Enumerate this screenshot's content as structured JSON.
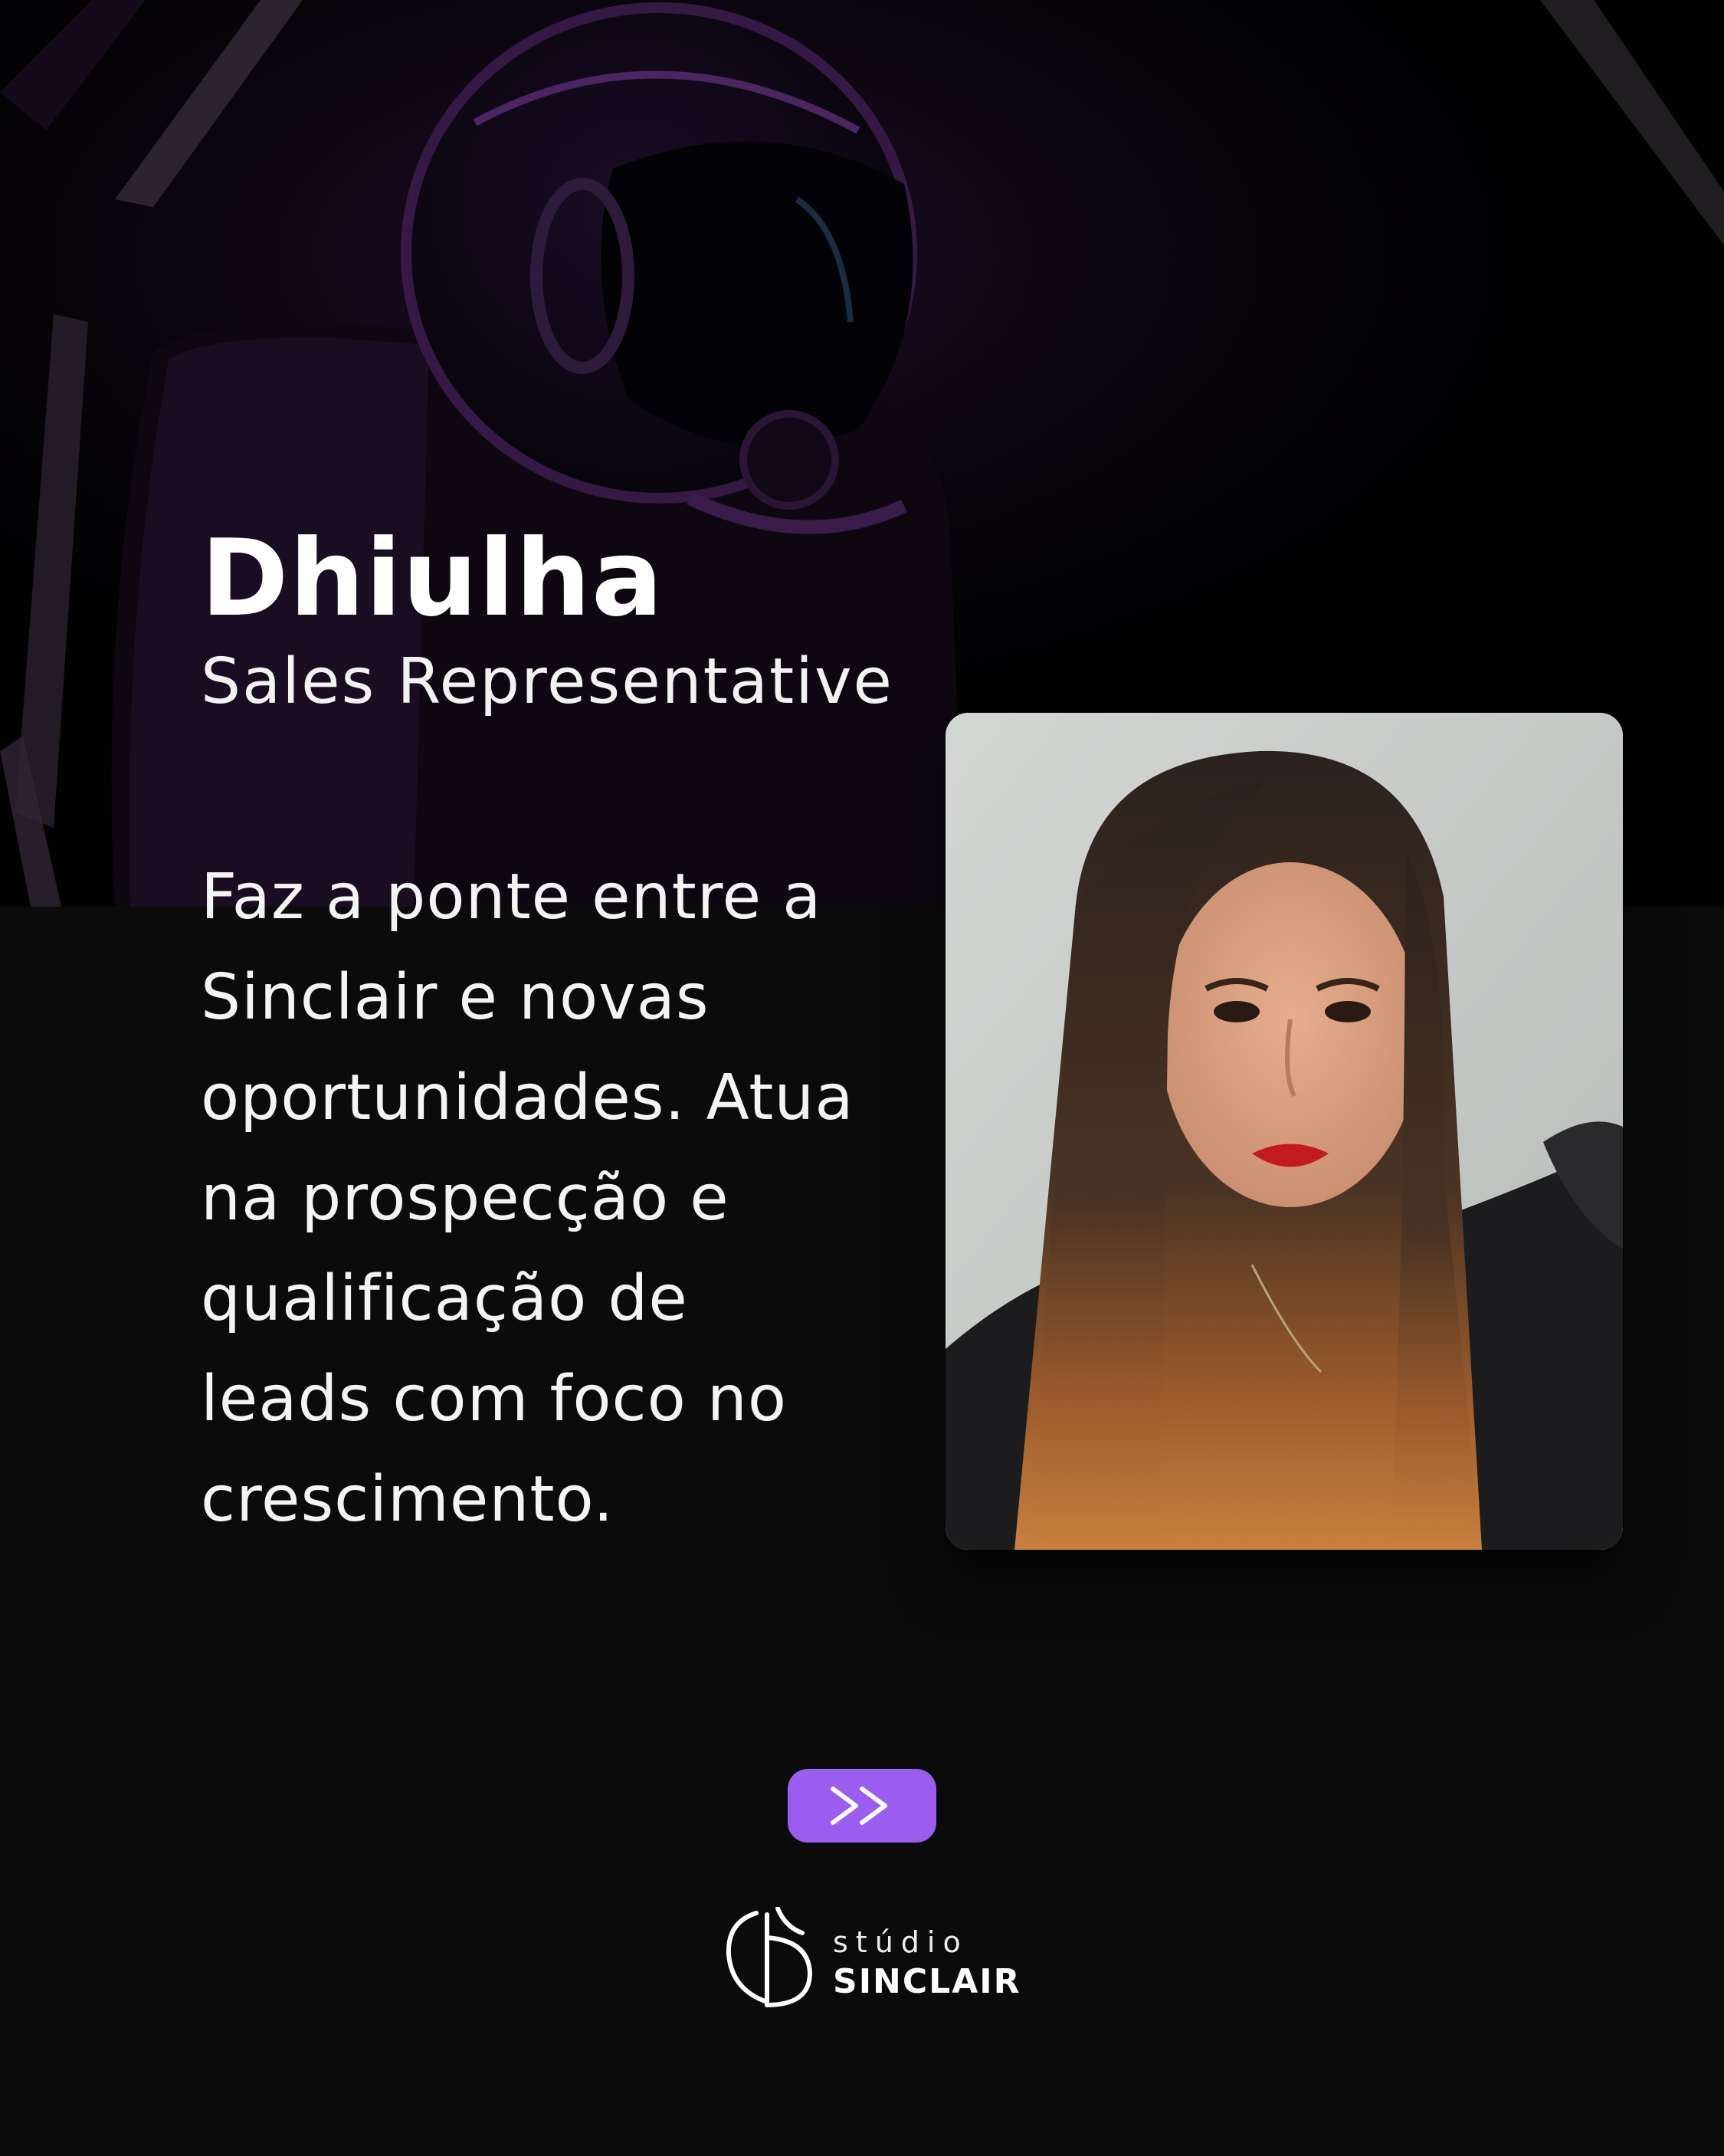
{
  "profile": {
    "name": "Dhiulha",
    "role": "Sales Representative",
    "bio": "Faz a ponte entre a\nSinclair e novas\noportunidades. Atua\nna prospecção e\nqualificação de\nleads com foco no\ncrescimento."
  },
  "navigation": {
    "next_label": ">>"
  },
  "brand": {
    "line1": "stúdio",
    "line2": "SINCLAIR"
  },
  "colors": {
    "background": "#0b0b0c",
    "hero_background": "#020203",
    "accent": "#9a5df0",
    "text": "#ffffff"
  },
  "icons": {
    "next": "double-chevron-right-icon",
    "logo": "studio-sinclair-logo-mark"
  }
}
